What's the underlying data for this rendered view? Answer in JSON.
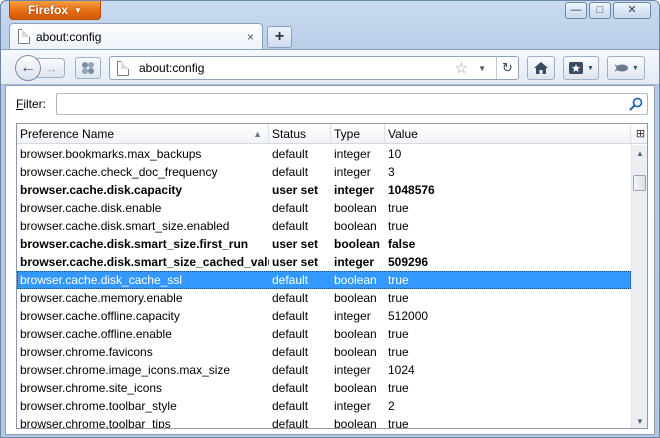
{
  "app": {
    "button_label": "Firefox"
  },
  "window_controls": {
    "minimize": "—",
    "maximize": "□",
    "close": "✕"
  },
  "tab": {
    "title": "about:config",
    "close": "×"
  },
  "new_tab_label": "+",
  "nav": {
    "back": "←",
    "forward": "→",
    "url": "about:config",
    "star": "☆",
    "dropdown": "▾",
    "reload": "↻",
    "home": "⌂"
  },
  "filter": {
    "label_underlined": "F",
    "label_rest": "ilter:",
    "value": "",
    "placeholder": ""
  },
  "table": {
    "headers": {
      "name": "Preference Name",
      "status": "Status",
      "type": "Type",
      "value": "Value"
    },
    "sort_indicator": "▲",
    "column_picker": "⊞",
    "rows": [
      {
        "name": "browser.bookmarks.max_backups",
        "status": "default",
        "type": "integer",
        "value": "10"
      },
      {
        "name": "browser.cache.check_doc_frequency",
        "status": "default",
        "type": "integer",
        "value": "3"
      },
      {
        "name": "browser.cache.disk.capacity",
        "status": "user set",
        "type": "integer",
        "value": "1048576"
      },
      {
        "name": "browser.cache.disk.enable",
        "status": "default",
        "type": "boolean",
        "value": "true"
      },
      {
        "name": "browser.cache.disk.smart_size.enabled",
        "status": "default",
        "type": "boolean",
        "value": "true"
      },
      {
        "name": "browser.cache.disk.smart_size.first_run",
        "status": "user set",
        "type": "boolean",
        "value": "false"
      },
      {
        "name": "browser.cache.disk.smart_size_cached_value",
        "status": "user set",
        "type": "integer",
        "value": "509296"
      },
      {
        "name": "browser.cache.disk_cache_ssl",
        "status": "default",
        "type": "boolean",
        "value": "true"
      },
      {
        "name": "browser.cache.memory.enable",
        "status": "default",
        "type": "boolean",
        "value": "true"
      },
      {
        "name": "browser.cache.offline.capacity",
        "status": "default",
        "type": "integer",
        "value": "512000"
      },
      {
        "name": "browser.cache.offline.enable",
        "status": "default",
        "type": "boolean",
        "value": "true"
      },
      {
        "name": "browser.chrome.favicons",
        "status": "default",
        "type": "boolean",
        "value": "true"
      },
      {
        "name": "browser.chrome.image_icons.max_size",
        "status": "default",
        "type": "integer",
        "value": "1024"
      },
      {
        "name": "browser.chrome.site_icons",
        "status": "default",
        "type": "boolean",
        "value": "true"
      },
      {
        "name": "browser.chrome.toolbar_style",
        "status": "default",
        "type": "integer",
        "value": "2"
      },
      {
        "name": "browser.chrome.toolbar_tips",
        "status": "default",
        "type": "boolean",
        "value": "true"
      }
    ],
    "modified_rows": [
      2,
      5,
      6
    ],
    "selected_row": 7
  },
  "colors": {
    "selection": "#3399ff",
    "app_button": "#e66c12",
    "chrome": "#c9daf0"
  },
  "icons": {
    "app": "firefox-app-button",
    "page": "page-icon",
    "search": "magnifier-icon",
    "bookmarks": "bookmarks-menu-icon",
    "addon": "addon-bar-icon"
  }
}
